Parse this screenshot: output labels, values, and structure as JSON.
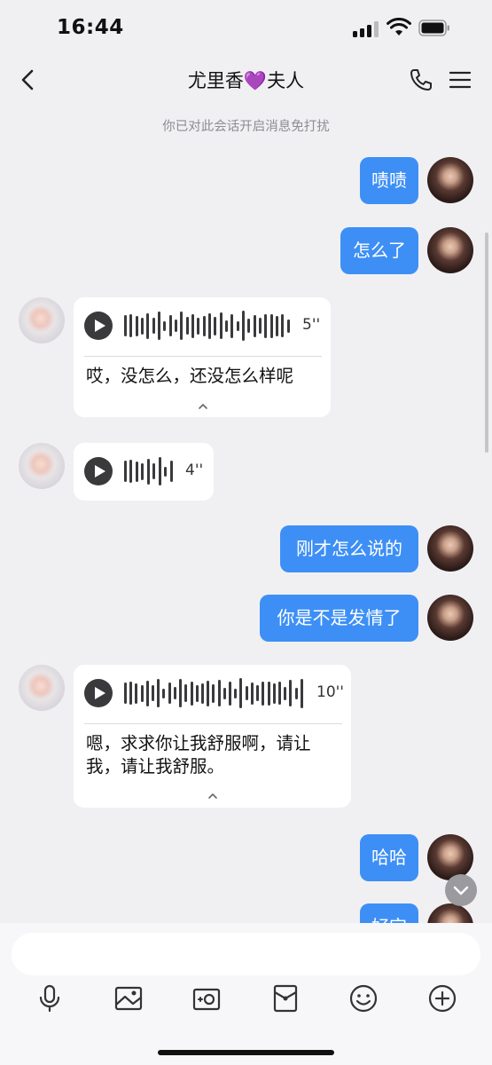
{
  "status_bar": {
    "time": "16:44"
  },
  "header": {
    "title": "尤里香💜夫人"
  },
  "notice": "你已对此会话开启消息免打扰",
  "messages": [
    {
      "type": "text",
      "from": "me",
      "text": "啧啧"
    },
    {
      "type": "text",
      "from": "me",
      "text": "怎么了"
    },
    {
      "type": "voice",
      "from": "other",
      "duration": "5''",
      "transcript": "哎，没怎么，还没怎么样呢"
    },
    {
      "type": "voice",
      "from": "other",
      "duration": "4''"
    },
    {
      "type": "text",
      "from": "me",
      "text": "刚才怎么说的"
    },
    {
      "type": "text",
      "from": "me",
      "text": "你是不是发情了"
    },
    {
      "type": "voice",
      "from": "other",
      "duration": "10''",
      "transcript_line1": "嗯，求求你让我舒服啊，请让",
      "transcript_line2": "我，请让我舒服。"
    },
    {
      "type": "text",
      "from": "me",
      "text": "哈哈"
    },
    {
      "type": "text",
      "from": "me",
      "text": "好宝",
      "partially_hidden": true
    }
  ],
  "toolbar": {
    "icons": [
      "microphone-icon",
      "image-icon",
      "camera-icon",
      "red-packet-icon",
      "emoji-icon",
      "plus-icon"
    ]
  },
  "colors": {
    "bubble_me": "#3d8ff5",
    "background": "#f0f0f3"
  }
}
